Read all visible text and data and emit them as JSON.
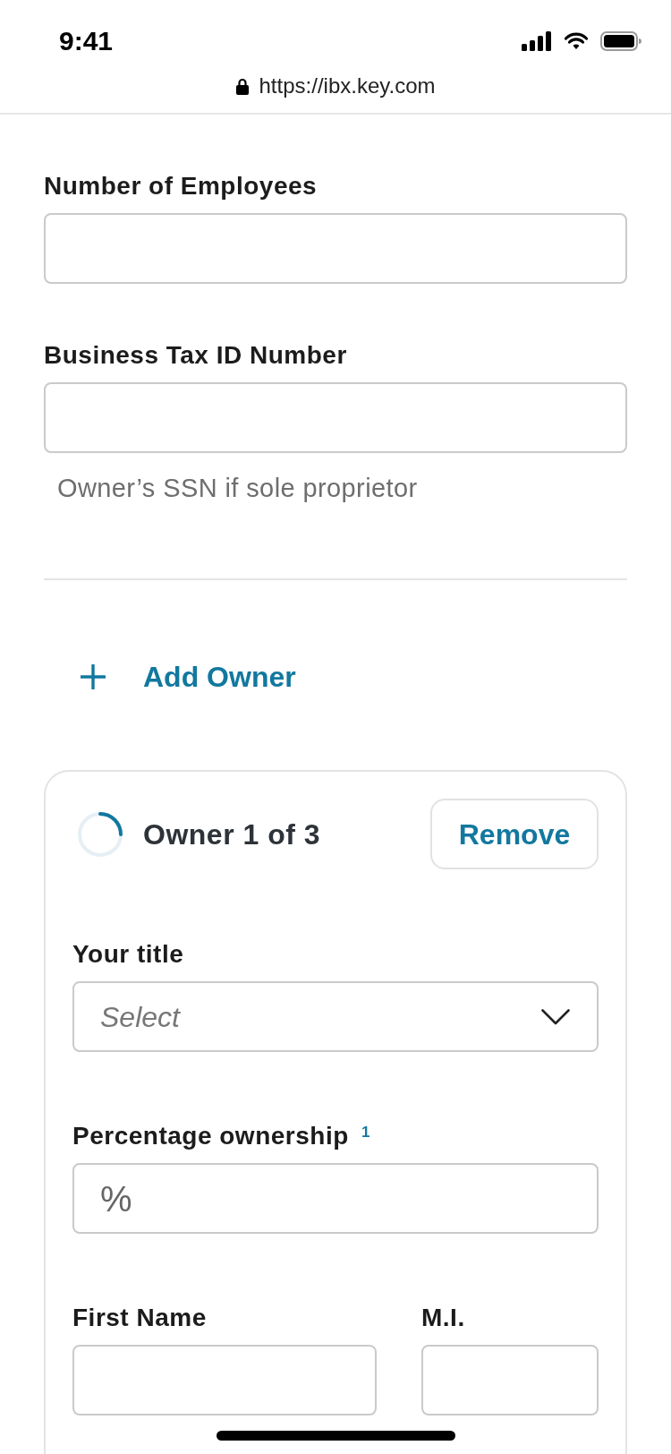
{
  "status_bar": {
    "time": "9:41"
  },
  "address_bar": {
    "url": "https://ibx.key.com"
  },
  "fields": [
    {
      "label": "Number of Employees"
    },
    {
      "label": "Business Tax ID Number",
      "hint": "Owner’s SSN if sole proprietor"
    }
  ],
  "add_owner": {
    "label": "Add Owner"
  },
  "owner_card": {
    "title": "Owner 1 of 3",
    "remove_button": "Remove",
    "fields": [
      {
        "kind": "select",
        "label": "Your title",
        "placeholder": "Select"
      },
      {
        "kind": "prefix",
        "label": "Percentage ownership $^{1}$",
        "prefix": "%"
      },
      {
        "kind": "split",
        "columns": [
          {
            "label": "First Name"
          },
          {
            "label": "M.I."
          }
        ]
      }
    ]
  }
}
